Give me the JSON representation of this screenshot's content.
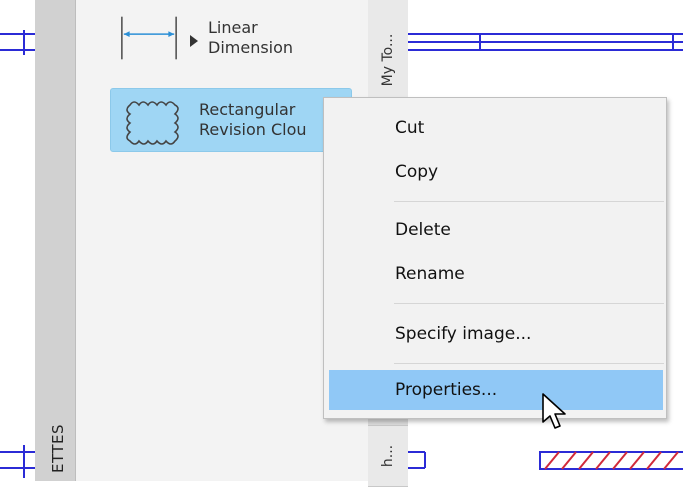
{
  "palette": {
    "title": "ETTES",
    "tabs": [
      "My To...",
      "h..."
    ],
    "tools": [
      {
        "label_line1": "Linear",
        "label_line2": "Dimension",
        "icon": "linear-dimension-icon"
      },
      {
        "label_line1": "Rectangular",
        "label_line2": "Revision Clou",
        "icon": "revision-cloud-icon",
        "selected": true
      }
    ]
  },
  "context_menu": {
    "items": [
      "Cut",
      "Copy",
      "Delete",
      "Rename",
      "Specify image...",
      "Properties..."
    ],
    "highlighted": "Properties..."
  },
  "colors": {
    "selection": "#9fd6f4",
    "menu_highlight": "#90c8f6",
    "drawing_blue": "#2b2bd6",
    "hatch_red": "#d12a3a"
  }
}
